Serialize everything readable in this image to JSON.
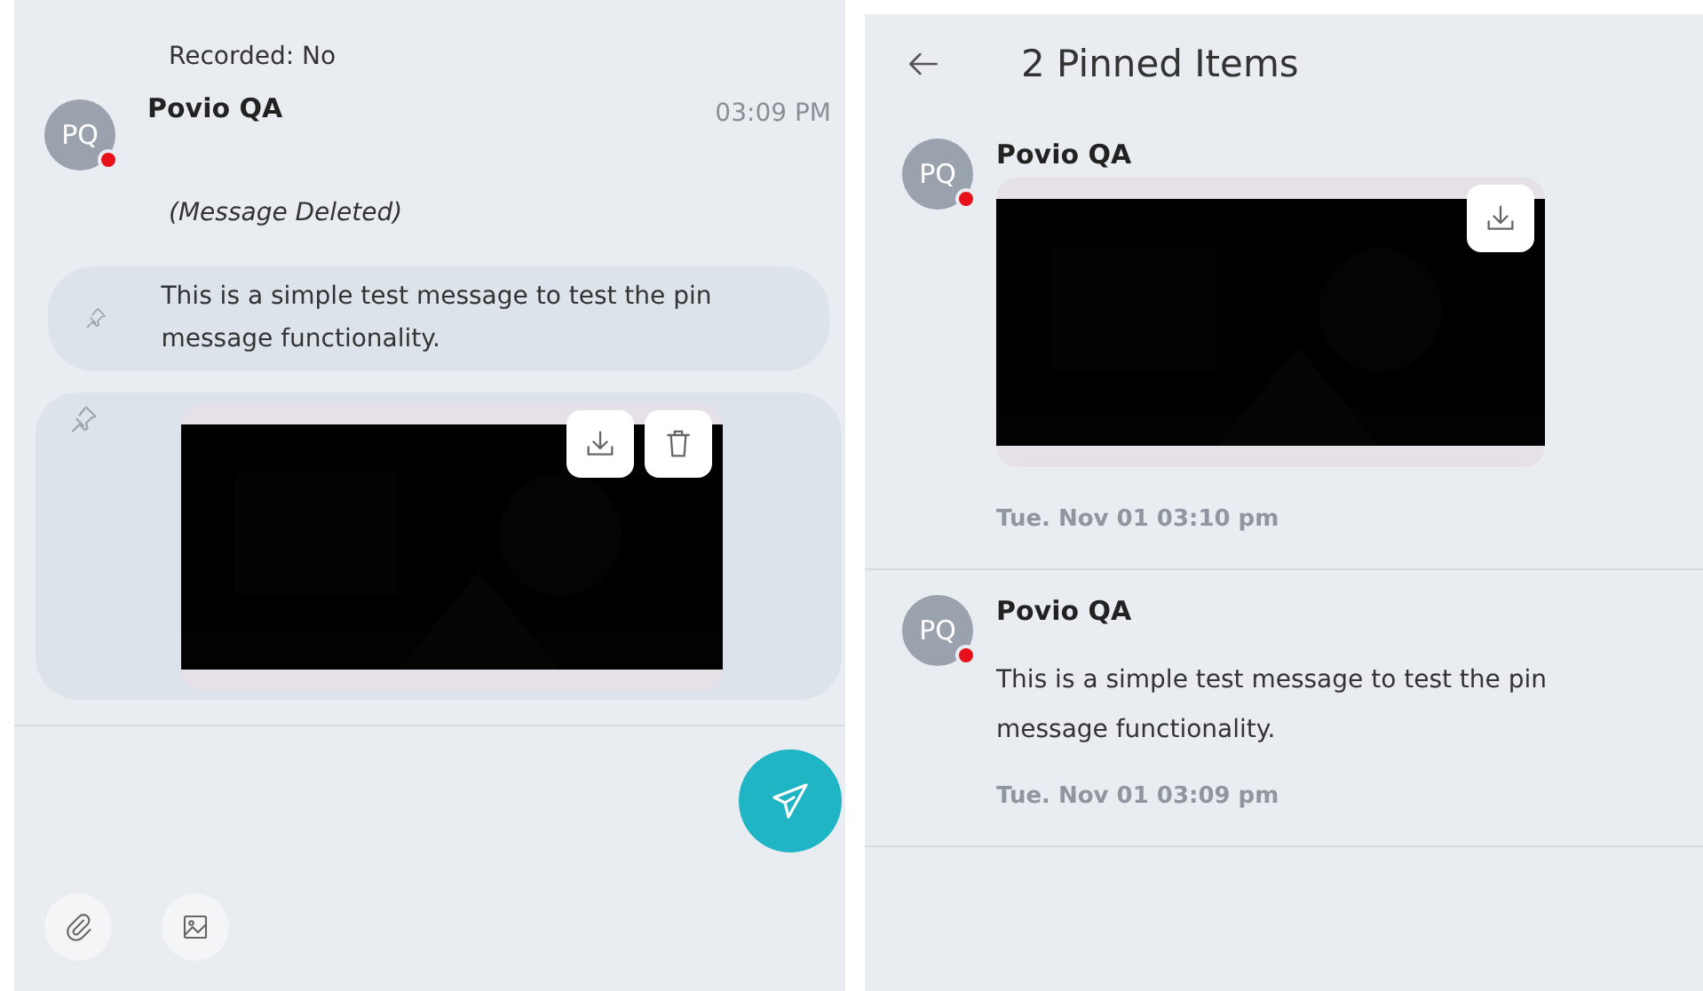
{
  "chat": {
    "call_info": "Recorded: No",
    "message": {
      "author": "Povio QA",
      "avatar": {
        "initials": "PQ",
        "color": "#e8101a"
      },
      "time": "03:09 PM",
      "items": [
        {
          "kind": "deleted",
          "text": "(Message Deleted)",
          "pinned": false
        },
        {
          "kind": "text",
          "text": "This is a simple test message to test the pin message functionality.",
          "pinned": true
        },
        {
          "kind": "video",
          "pinned": true,
          "deletable": true
        }
      ]
    }
  },
  "pinned_panel": {
    "title": "2 Pinned Items",
    "items": [
      {
        "author": "Povio QA",
        "avatar": {
          "initials": "PQ",
          "color": "#e8101a"
        },
        "kind": "video",
        "deletable": false,
        "timestamp": "Tue. Nov 01 03:10 pm"
      },
      {
        "author": "Povio QA",
        "avatar": {
          "initials": "PQ",
          "color": "#e8101a"
        },
        "kind": "text",
        "text": "This is a simple test message to test the pin message functionality.",
        "timestamp": "Tue. Nov 01 03:09 pm"
      }
    ]
  }
}
